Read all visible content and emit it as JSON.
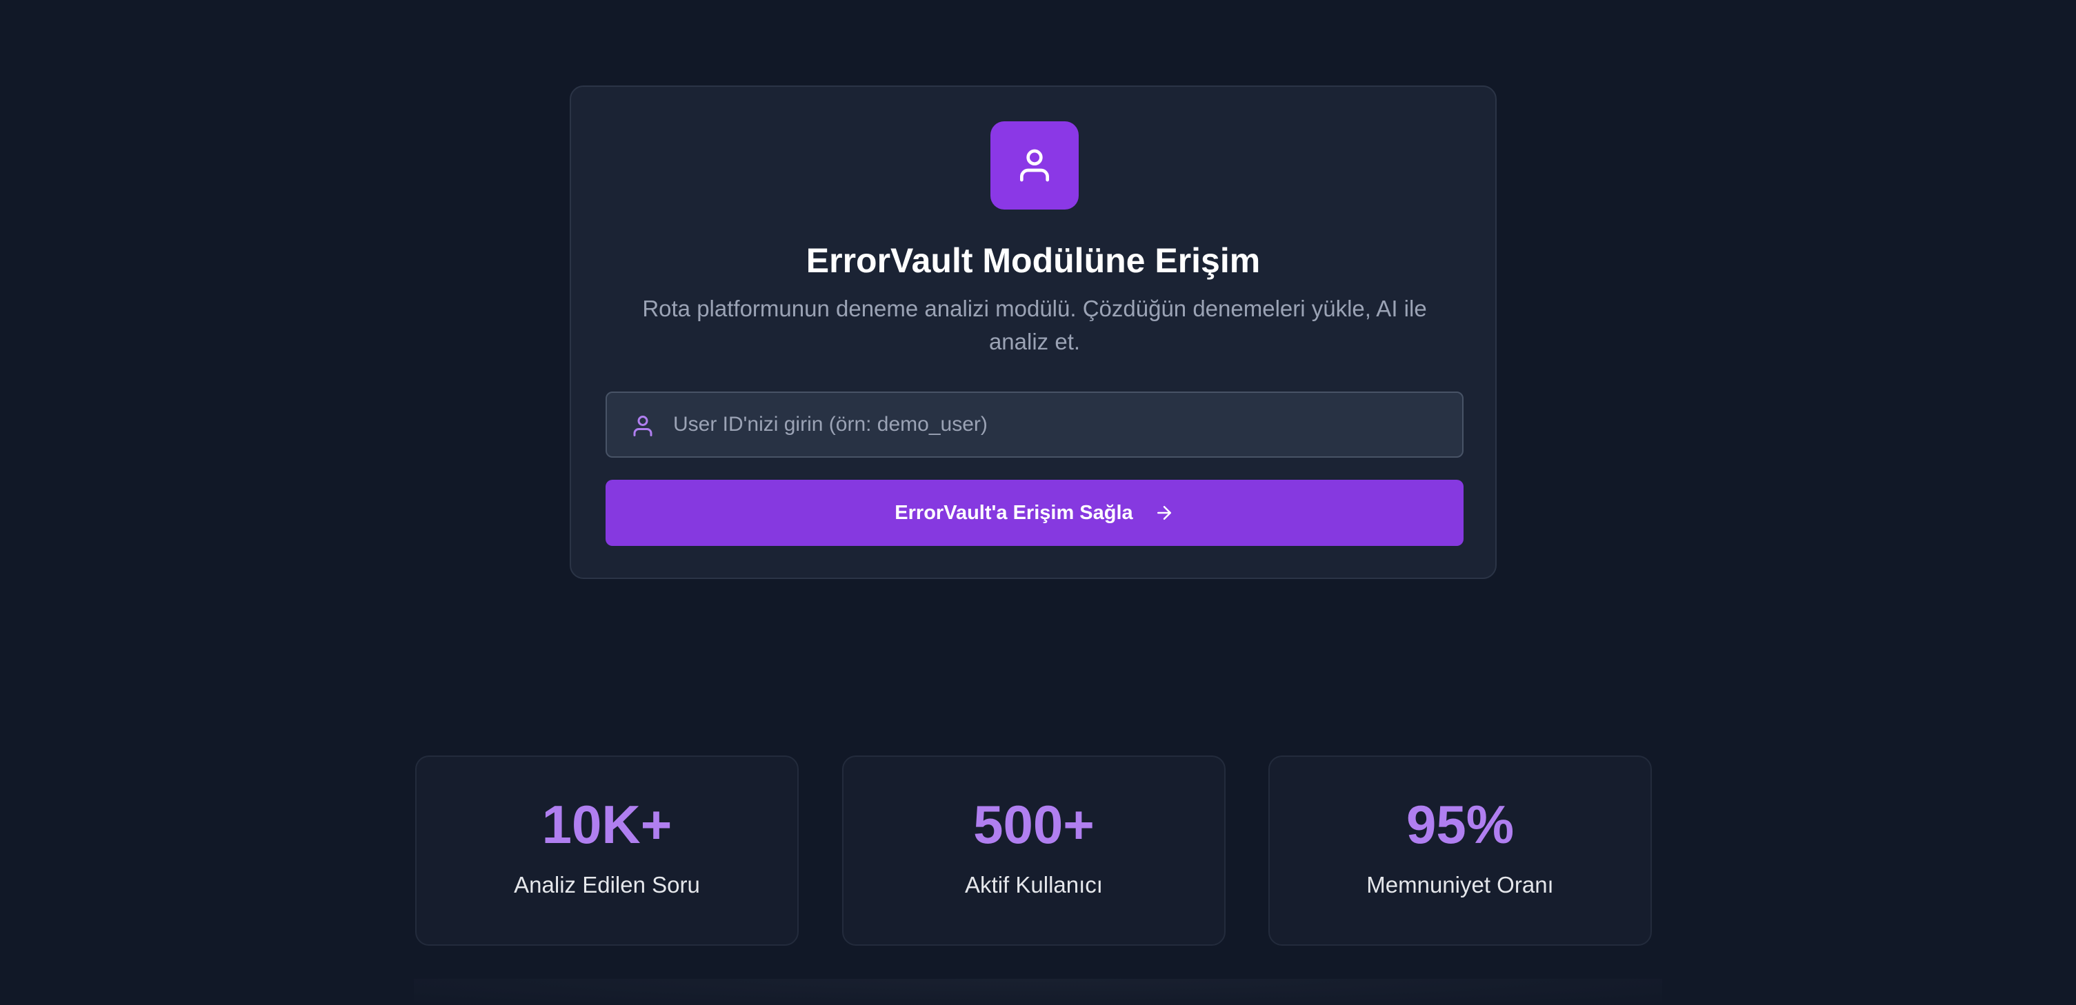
{
  "login_card": {
    "app_icon": "user-icon",
    "title": "ErrorVault Modülüne Erişim",
    "subtitle": "Rota platformunun deneme analizi modülü. Çözdüğün denemeleri yükle, AI ile analiz et.",
    "user_input": {
      "icon": "user-icon",
      "value": "",
      "placeholder": "User ID'nizi girin (örn: demo_user)"
    },
    "submit_button": {
      "label": "ErrorVault'a Erişim Sağla",
      "icon": "arrow-right-icon"
    }
  },
  "stats": [
    {
      "value": "10K+",
      "label": "Analiz Edilen Soru"
    },
    {
      "value": "500+",
      "label": "Aktif Kullanıcı"
    },
    {
      "value": "95%",
      "label": "Memnuniyet Oranı"
    }
  ],
  "colors": {
    "background": "#111827",
    "card": "#1b2334",
    "accent": "#8639e0",
    "stat_value": "#b07ff0",
    "muted_text": "#9ba3b5"
  }
}
